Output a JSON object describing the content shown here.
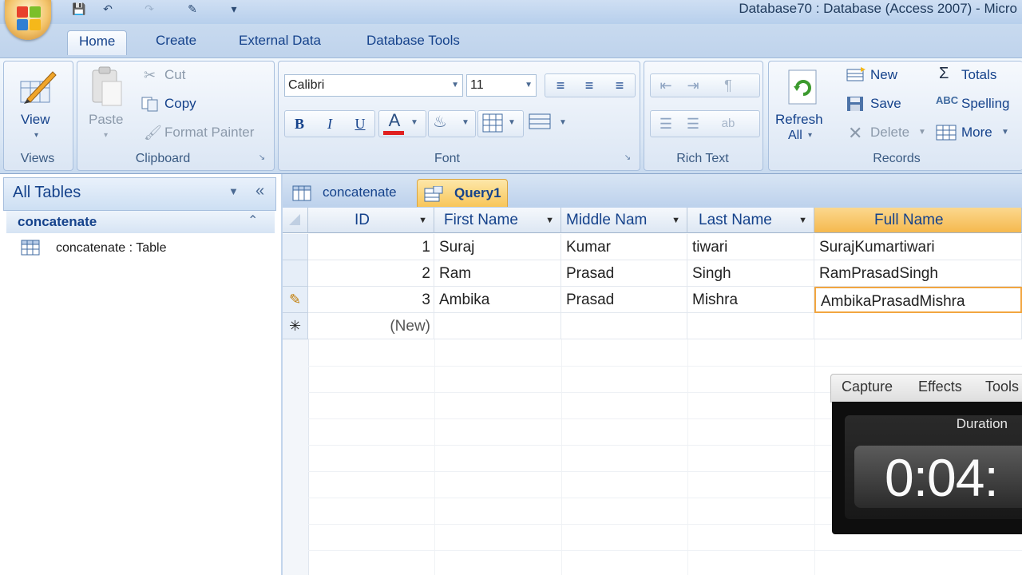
{
  "window": {
    "title": "Database70 : Database (Access 2007) - Micro"
  },
  "ribbon_tabs": [
    "Home",
    "Create",
    "External Data",
    "Database Tools"
  ],
  "ribbon": {
    "views": {
      "view_label": "View",
      "group_label": "Views"
    },
    "clipboard": {
      "paste": "Paste",
      "cut": "Cut",
      "copy": "Copy",
      "format_painter": "Format Painter",
      "group_label": "Clipboard"
    },
    "font": {
      "name": "Calibri",
      "size": "11",
      "bold": "B",
      "italic": "I",
      "underline": "U",
      "font_color_glyph": "A",
      "group_label": "Font"
    },
    "rich_text": {
      "group_label": "Rich Text"
    },
    "records": {
      "refresh_line1": "Refresh",
      "refresh_line2": "All",
      "new": "New",
      "save": "Save",
      "delete": "Delete",
      "totals": "Totals",
      "spelling": "Spelling",
      "more": "More",
      "group_label": "Records"
    },
    "colors": {
      "font_color_bar": "#e02020",
      "highlight_bar": "#f2f2f2"
    }
  },
  "nav_pane": {
    "header": "All Tables",
    "group": "concatenate",
    "items": [
      {
        "label": "concatenate : Table",
        "icon": "table-icon"
      }
    ]
  },
  "doc_tabs": [
    {
      "label": "concatenate",
      "icon": "table-icon"
    },
    {
      "label": "Query1",
      "icon": "query-icon",
      "active": true
    }
  ],
  "datasheet": {
    "columns": [
      "ID",
      "First Name",
      "Middle Nam",
      "Last Name",
      "Full Name"
    ],
    "rows": [
      {
        "id": "1",
        "first": "Suraj",
        "middle": "Kumar",
        "last": "tiwari",
        "full": "SurajKumartiwari"
      },
      {
        "id": "2",
        "first": "Ram",
        "middle": "Prasad",
        "last": "Singh",
        "full": "RamPrasadSingh"
      },
      {
        "id": "3",
        "first": "Ambika",
        "middle": "Prasad",
        "last": "Mishra",
        "full": "AmbikaPrasadMishra"
      }
    ],
    "new_row_label": "(New)",
    "selected_row_glyph": "✎",
    "new_row_glyph": "✳"
  },
  "recorder": {
    "tabs": [
      "Capture",
      "Effects",
      "Tools"
    ],
    "duration_label": "Duration",
    "time": "0:04:"
  }
}
